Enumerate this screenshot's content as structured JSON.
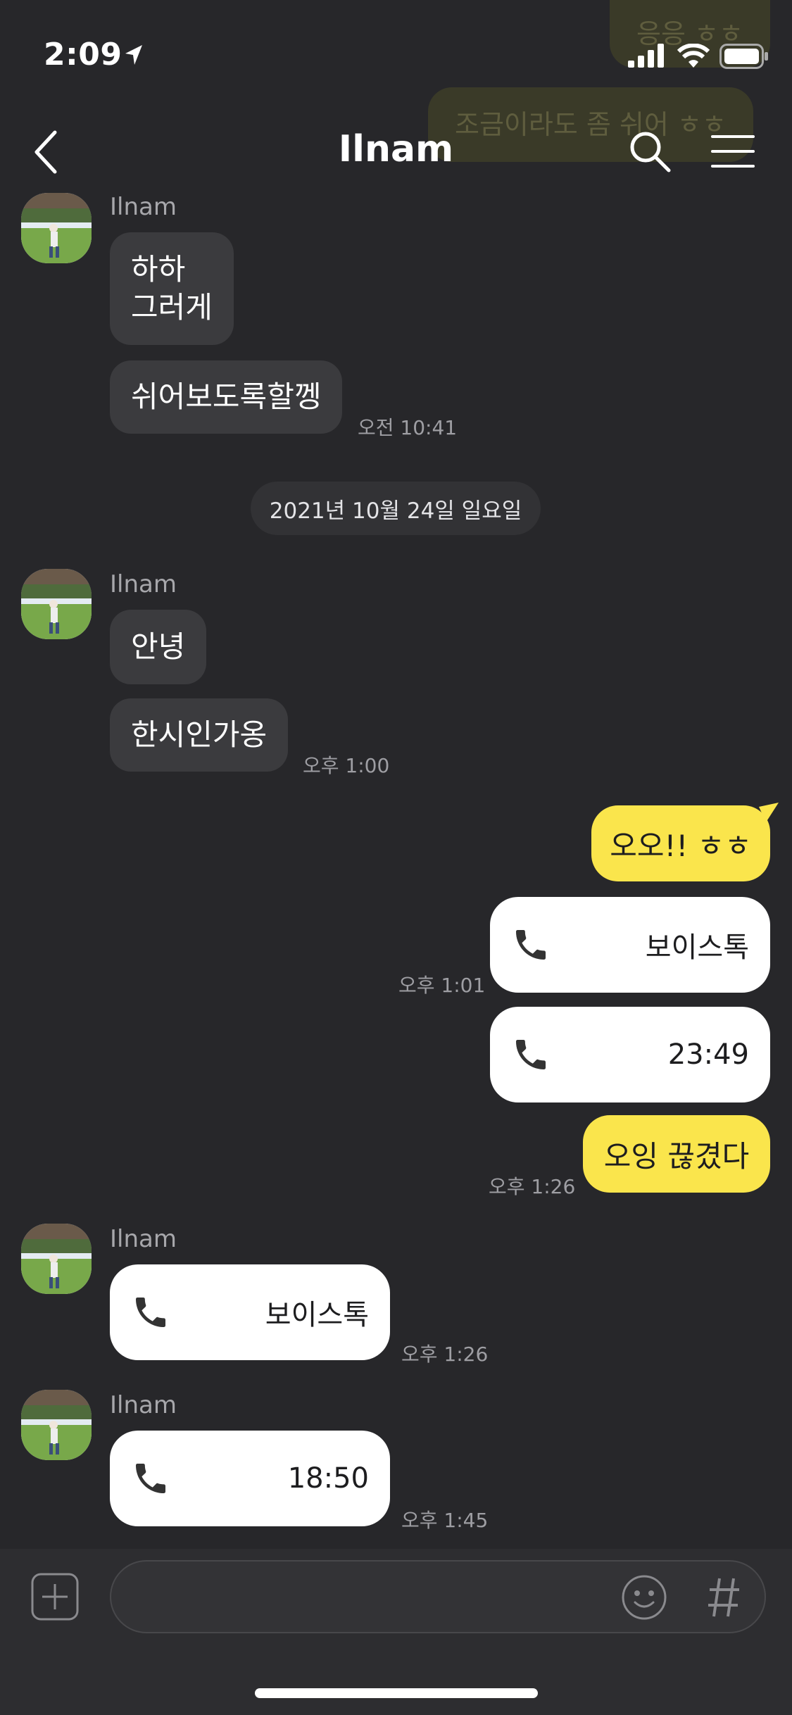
{
  "status_bar": {
    "time": "2:09"
  },
  "header": {
    "title": "Ilnam"
  },
  "background_messages": [
    {
      "text": "응응 ㅎㅎ"
    },
    {
      "text": "조금이라도 좀 쉬어 ㅎㅎ"
    }
  ],
  "groups": [
    {
      "sender": "Ilnam",
      "messages": [
        {
          "lines": [
            "하하",
            "그러게"
          ]
        },
        {
          "lines": [
            "쉬어보도록할껭"
          ]
        }
      ],
      "time": "오전 10:41"
    },
    {
      "sender": "Ilnam",
      "messages": [
        {
          "lines": [
            "안녕"
          ]
        },
        {
          "lines": [
            "한시인가옹"
          ]
        }
      ],
      "time": "오후 1:00"
    },
    {
      "sender": "Ilnam",
      "call_label": "보이스톡",
      "time": "오후 1:26"
    },
    {
      "sender": "Ilnam",
      "call_label": "18:50",
      "time": "오후 1:45"
    }
  ],
  "date_divider": "2021년 10월 24일 일요일",
  "outgoing": [
    {
      "text": "오오!! ㅎㅎ"
    },
    {
      "call_label": "보이스톡",
      "time": "오후 1:01"
    },
    {
      "call_label": "23:49"
    },
    {
      "text": "오잉 끊겼다",
      "time": "오후 1:26"
    }
  ],
  "input": {
    "placeholder": ""
  },
  "colors": {
    "background": "#27272a",
    "outgoing_bubble": "#fae54c",
    "incoming_bubble": "#3b3b3e",
    "call_bubble": "#ffffff"
  },
  "icons": [
    "location-arrow-icon",
    "signal-icon",
    "wifi-icon",
    "battery-icon",
    "back-chevron-icon",
    "search-icon",
    "menu-icon",
    "phone-icon",
    "plus-icon",
    "emoji-icon",
    "hashtag-icon"
  ]
}
